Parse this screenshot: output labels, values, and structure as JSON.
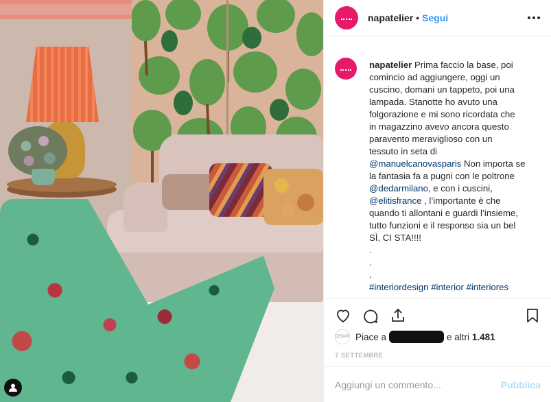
{
  "photo": {
    "colors": {
      "wall": "#cdb8ae",
      "wall_stripe_top": "#e88d7e",
      "screen": "#d9b49a",
      "sofa": "#e0ccc6",
      "chair": "#5fb68f",
      "lamp": "#e86d43"
    }
  },
  "header": {
    "username": "napatelier",
    "separator": "•",
    "follow_label": "Segui"
  },
  "caption": {
    "username": "napatelier",
    "lines": [
      "Prima faccio la base, poi",
      "comincio ad aggiungere, oggi un",
      "cuscino, domani un tappeto, poi una",
      "lampada. Stanotte ho avuto una",
      "folgorazione e mi sono ricordata che",
      "in magazzino avevo ancora questo",
      "paravento meraviglioso con un",
      "tessuto in seta di"
    ],
    "mention1": "@manuelcanovasparis",
    "after_mention1": " Non importa se",
    "line_b": "la fantasia fa a pugni con le poltrone",
    "mention2": "@dedarmilano",
    "after_mention2": ", e con i cuscini,",
    "mention3": "@elitisfrance",
    "after_mention3": " , l’importante è che",
    "line_c": "quando ti allontani e guardi l’insieme,",
    "line_d": "tutto funzioni e il responso sia un bel",
    "line_e": "SÌ, CI STA!!!!",
    "dots": [
      ".",
      ".",
      "."
    ],
    "tag1": "#interiordesign",
    "tag2": "#interior",
    "tag3": "#interiores"
  },
  "likes": {
    "avatar_text": "DEDAR",
    "prefix": "Piace a",
    "suffix": "e altri",
    "count": "1.481"
  },
  "date": "7 SETTEMBRE",
  "comment_box": {
    "placeholder": "Aggiungi un commento...",
    "publish_label": "Pubblica"
  },
  "icons": [
    "heart-icon",
    "comment-icon",
    "share-icon",
    "bookmark-icon",
    "more-icon",
    "user-tag-icon"
  ]
}
